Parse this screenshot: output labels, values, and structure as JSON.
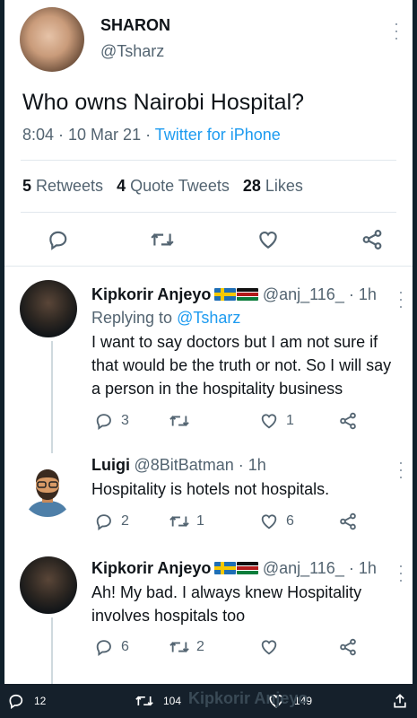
{
  "main_tweet": {
    "name": "SHARON",
    "handle": "@Tsharz",
    "text": "Who owns Nairobi Hospital?",
    "time_date": "8:04 · 10 Mar 21 · ",
    "source": "Twitter for iPhone",
    "retweets_count": "5",
    "retweets_label": " Retweets",
    "quotes_count": "4",
    "quotes_label": " Quote Tweets",
    "likes_count": "28",
    "likes_label": " Likes"
  },
  "replies": [
    {
      "name": "Kipkorir Anjeyo",
      "handle": "@anj_116_ · 1h",
      "replying_prefix": "Replying to ",
      "replying_to": "@Tsharz",
      "text": "I want to say doctors but I am not sure if that would be the truth or not. So I will say a person in the hospitality business",
      "reply_count": "3",
      "retweet_count": "",
      "like_count": "1"
    },
    {
      "name": "Luigi",
      "handle": "@8BitBatman · 1h",
      "text": "Hospitality is hotels not hospitals.",
      "reply_count": "2",
      "retweet_count": "1",
      "like_count": "6"
    },
    {
      "name": "Kipkorir Anjeyo",
      "handle": "@anj_116_ · 1h",
      "text": "Ah! My bad. I always knew Hospitality involves hospitals too",
      "reply_count": "6",
      "retweet_count": "2",
      "like_count": ""
    }
  ],
  "bottom_bar": {
    "reply_count": "12",
    "retweet_count": "104",
    "like_count": "149",
    "ghost_text": "Kipkorir Anjeyo"
  },
  "icons": [
    "more-icon",
    "reply-icon",
    "retweet-icon",
    "like-icon",
    "share-icon",
    "sweden-flag-icon",
    "kenya-flag-icon"
  ],
  "colors": {
    "accent": "#1d9bf0",
    "secondary_text": "#536471",
    "bottom_bar": "#15202b"
  }
}
